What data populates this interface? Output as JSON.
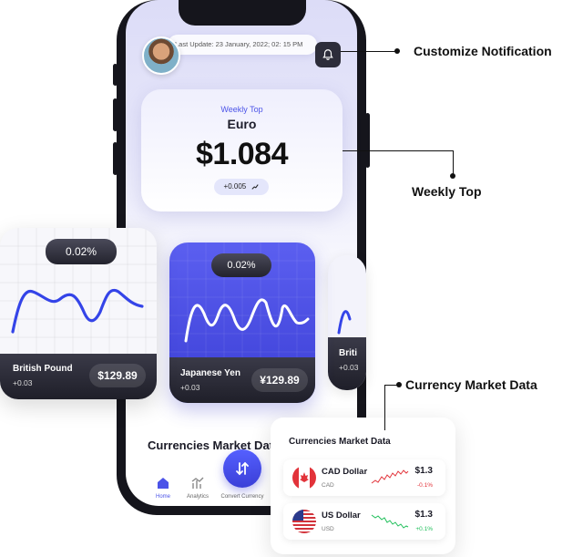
{
  "header": {
    "last_update": "Last Update: 23 January, 2022; 02: 15 PM"
  },
  "weekly": {
    "label": "Weekly Top",
    "currency": "Euro",
    "value": "$1.084",
    "change": "+0.005"
  },
  "cards": [
    {
      "name": "British Pound",
      "change": "+0.03",
      "price": "$129.89",
      "percent": "0.02%"
    },
    {
      "name": "Japanese Yen",
      "change": "+0.03",
      "price": "¥129.89",
      "percent": "0.02%"
    },
    {
      "name": "Briti",
      "change": "+0.03",
      "price": "",
      "percent": ""
    }
  ],
  "section_title": "Currencies Market Data",
  "nav": {
    "home": "Home",
    "analytics": "Analytics",
    "convert": "Convert Currency"
  },
  "market_panel": {
    "title": "Currencies Market Data",
    "rows": [
      {
        "name": "CAD Dollar",
        "code": "CAD",
        "value": "$1.3",
        "change": "-0.1%",
        "trend": "down"
      },
      {
        "name": "US Dollar",
        "code": "USD",
        "value": "$1.3",
        "change": "+0.1%",
        "trend": "up"
      }
    ]
  },
  "callouts": {
    "notification": "Customize Notification",
    "weekly": "Weekly Top",
    "market": "Currency Market Data"
  },
  "colors": {
    "accent": "#4b53e8",
    "up": "#1fbf5a",
    "down": "#e2333a"
  },
  "icons": {
    "bell": "bell-icon",
    "home": "home-icon",
    "analytics": "analytics-icon",
    "convert": "swap-arrows-icon",
    "trend": "trend-up-icon"
  }
}
